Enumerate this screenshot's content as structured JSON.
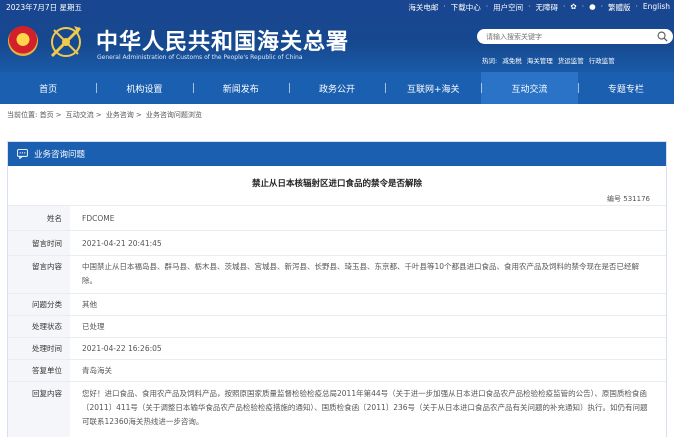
{
  "topbar": {
    "date": "2023年7月7日 星期五",
    "links": [
      "海关电邮",
      "下载中心",
      "用户空间",
      "无障碍",
      "繁體版",
      "English"
    ]
  },
  "brand": {
    "name_cn": "中华人民共和国海关总署",
    "name_en": "General Administration of Customs of the People's Republic of China"
  },
  "search": {
    "placeholder": "请输入搜索关键字",
    "hot_label": "热词:",
    "hot_words": [
      "减免税",
      "海关管理",
      "货运监管",
      "行政监管"
    ]
  },
  "nav": [
    "首页",
    "机构设置",
    "新闻发布",
    "政务公开",
    "互联网+海关",
    "互动交流",
    "专题专栏"
  ],
  "nav_active": "互动交流",
  "breadcrumb": {
    "label": "当前位置:",
    "items": [
      "首页",
      "互动交流",
      "业务咨询",
      "业务咨询问题浏览"
    ]
  },
  "panel": {
    "title": "业务咨询问题",
    "question_title": "禁止从日本核辐射区进口食品的禁令是否解除",
    "serial": "编号 531176",
    "fields": [
      {
        "label": "姓名",
        "value": "FDCOME"
      },
      {
        "label": "留言时间",
        "value": "2021-04-21 20:41:45"
      },
      {
        "label": "留言内容",
        "value": "中国禁止从日本福岛县、群马县、栃木县、茨城县、宫城县、新泻县、长野县、琦玉县、东京都、千叶县等10个都县进口食品、食用农产品及饲料的禁令现在是否已经解除。"
      },
      {
        "label": "问题分类",
        "value": "其他"
      },
      {
        "label": "处理状态",
        "value": "已处理"
      },
      {
        "label": "处理时间",
        "value": "2021-04-22 16:26:05"
      },
      {
        "label": "答复单位",
        "value": "青岛海关"
      },
      {
        "label": "回复内容",
        "value": "您好！进口食品、食用农产品及饲料产品，按照原国家质量监督检验检疫总局2011年第44号（关于进一步加强从日本进口食品农产品检验检疫监管的公告）、原国质检食函〔2011〕411号（关于调整日本输华食品农产品检验检疫措施的通知）、国质检食函〔2011〕236号（关于从日本进口食品农产品有关问题的补充通知）执行。如仍有问题可联系12360海关热线进一步咨询。"
      }
    ]
  }
}
